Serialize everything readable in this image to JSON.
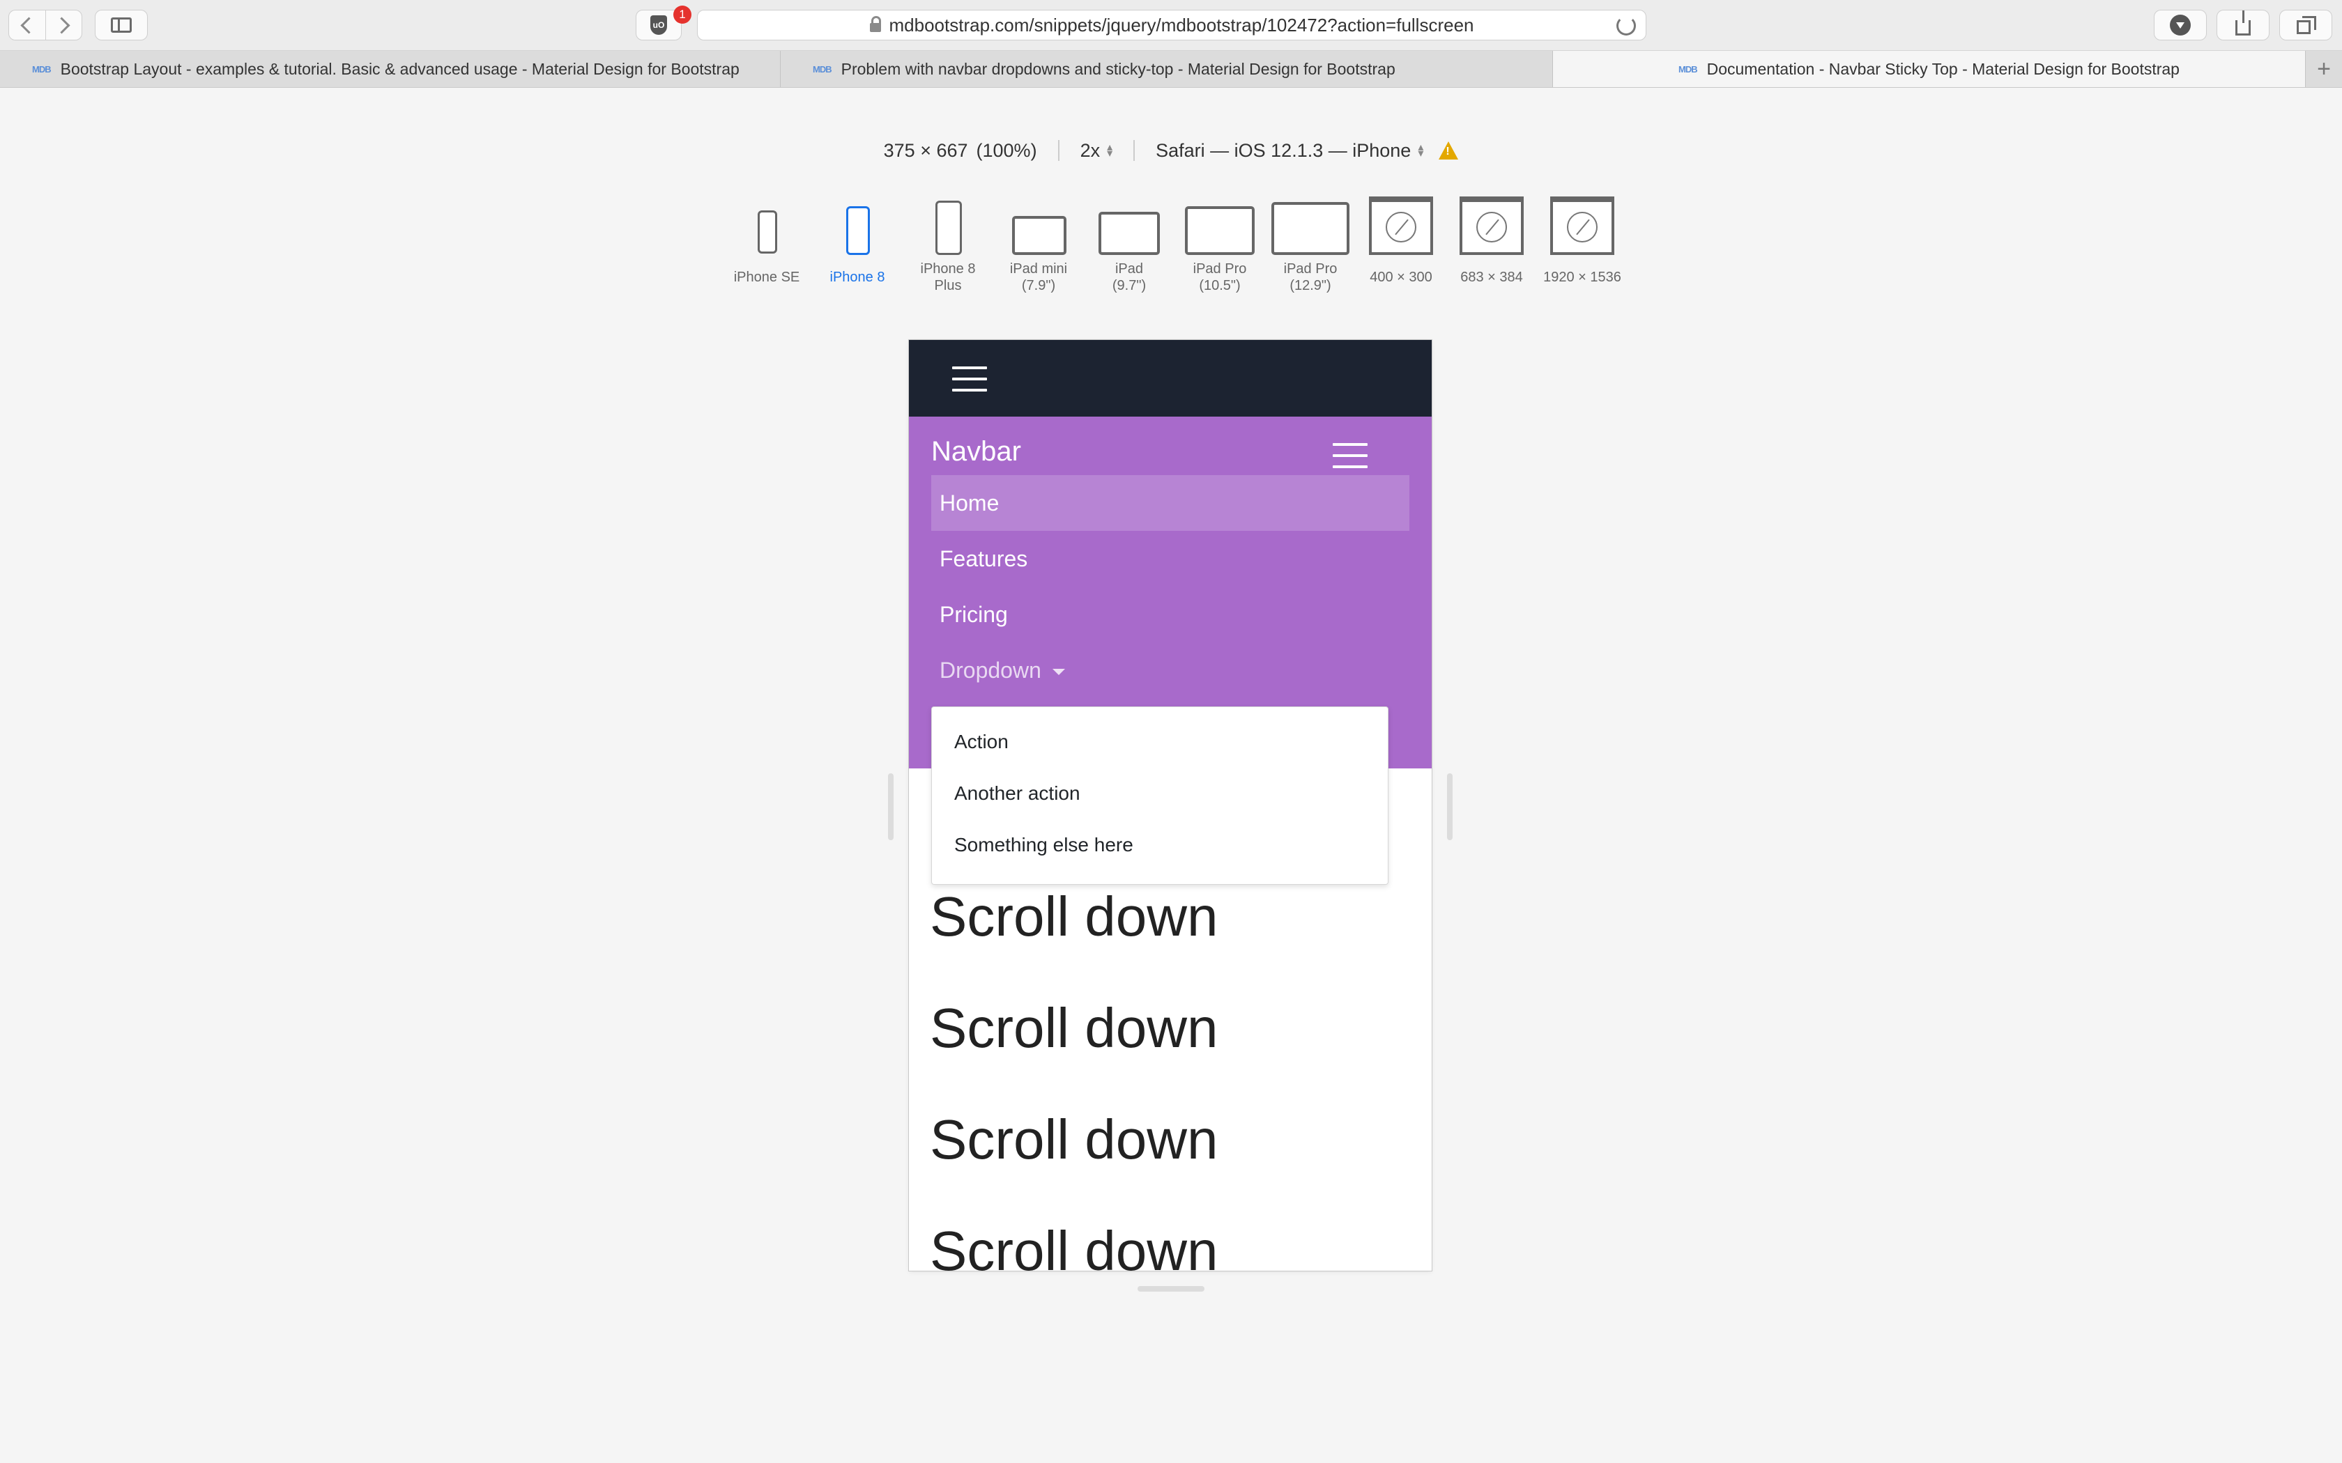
{
  "browser": {
    "url": "mdbootstrap.com/snippets/jquery/mdbootstrap/102472?action=fullscreen",
    "ublock_count": "1",
    "ublock_label": "uO",
    "tabs": [
      {
        "title": "Bootstrap Layout - examples & tutorial. Basic & advanced usage - Material Design for Bootstrap",
        "favicon": "MDB"
      },
      {
        "title": "Problem with navbar dropdowns and sticky-top - Material Design for Bootstrap",
        "favicon": "MDB"
      },
      {
        "title": "Documentation - Navbar Sticky Top - Material Design for Bootstrap",
        "favicon": "MDB"
      }
    ],
    "new_tab_label": "+"
  },
  "responsive": {
    "size": "375 × 667",
    "zoom": "(100%)",
    "pixel_ratio": "2x",
    "user_agent": "Safari — iOS 12.1.3 — iPhone",
    "devices": [
      {
        "line1": "iPhone SE",
        "line2": ""
      },
      {
        "line1": "iPhone 8",
        "line2": ""
      },
      {
        "line1": "iPhone 8",
        "line2": "Plus"
      },
      {
        "line1": "iPad mini",
        "line2": "(7.9\")"
      },
      {
        "line1": "iPad",
        "line2": "(9.7\")"
      },
      {
        "line1": "iPad Pro",
        "line2": "(10.5\")"
      },
      {
        "line1": "iPad Pro",
        "line2": "(12.9\")"
      },
      {
        "line1": "400 × 300",
        "line2": ""
      },
      {
        "line1": "683 × 384",
        "line2": ""
      },
      {
        "line1": "1920 × 1536",
        "line2": ""
      }
    ],
    "active_device": "iPhone 8"
  },
  "page": {
    "navbar": {
      "brand": "Navbar",
      "links": [
        "Home",
        "Features",
        "Pricing"
      ],
      "dropdown_label": "Dropdown",
      "dropdown_items": [
        "Action",
        "Another action",
        "Something else here"
      ]
    },
    "scroll_lines": [
      "Scroll down",
      "Scroll down",
      "Scroll down",
      "Scroll down"
    ]
  },
  "colors": {
    "dark_nav": "#1c2331",
    "purple_nav": "#a86acb",
    "active_device": "#1a73e8",
    "badge": "#e5322d"
  }
}
